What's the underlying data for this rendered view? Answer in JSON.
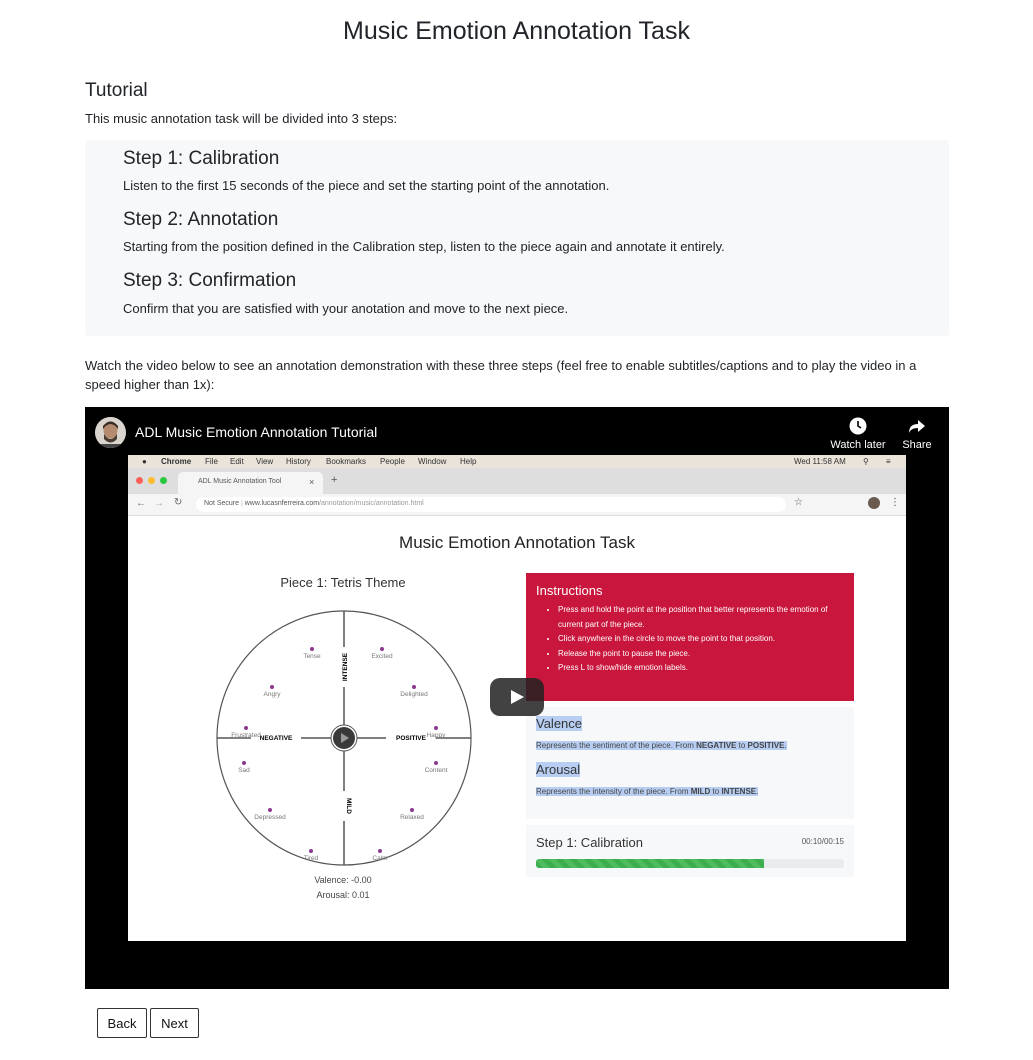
{
  "page": {
    "title": "Music Emotion Annotation Task",
    "section_title": "Tutorial",
    "intro": "This music annotation task will be divided into 3 steps:",
    "steps": [
      {
        "title": "Step 1: Calibration",
        "text": "Listen to the first 15 seconds of the piece and set the starting point of the annotation."
      },
      {
        "title": "Step 2: Annotation",
        "text": "Starting from the position defined in the Calibration step, listen to the piece again and annotate it entirely."
      },
      {
        "title": "Step 3: Confirmation",
        "text": "Confirm that you are satisfied with your anotation and move to the next piece."
      }
    ],
    "video_text": "Watch the video below to see an annotation demonstration with these three steps (feel free to enable subtitles/captions and to play the video in a speed higher than 1x):"
  },
  "video": {
    "title": "ADL Music Emotion Annotation Tutorial",
    "watch_later": "Watch later",
    "share": "Share",
    "screen": {
      "menubar": [
        "Chrome",
        "File",
        "Edit",
        "View",
        "History",
        "Bookmarks",
        "People",
        "Window",
        "Help"
      ],
      "clock": "Wed 11:58 AM",
      "tab_title": "ADL Music Annotation Tool",
      "tab_close": "×",
      "new_tab": "+",
      "url_secure": "Not Secure",
      "url_host": "www.lucasnferreira.com",
      "url_path": "/annotation/music/annotation.html",
      "page_title": "Music Emotion Annotation Task",
      "piece_title": "Piece 1: Tetris Theme",
      "axis_labels": {
        "negative": "NEGATIVE",
        "positive": "POSITIVE",
        "intense": "INTENSE",
        "mild": "MILD"
      },
      "emotions": [
        "Tense",
        "Excited",
        "Angry",
        "Delighted",
        "Frustrated",
        "Happy",
        "Sad",
        "Content",
        "Depressed",
        "Relaxed",
        "Tired",
        "Calm"
      ],
      "valence_readout": "Valence: -0.00",
      "arousal_readout": "Arousal: 0.01",
      "instructions_title": "Instructions",
      "instructions": [
        "Press and hold the point at the position that better represents the emotion of current part of the piece.",
        "Click anywhere in the circle to move the point to that position.",
        "Release the point to pause the piece.",
        "Press L to show/hide emotion labels."
      ],
      "valence_title": "Valence",
      "valence_desc_1": "Represents the sentiment of the piece. From ",
      "valence_neg": "NEGATIVE",
      "valence_to": " to ",
      "valence_pos": "POSITIVE",
      "valence_end": ".",
      "arousal_title": "Arousal",
      "arousal_desc_1": "Represents the intensity of the piece. From ",
      "arousal_mild": "MILD",
      "arousal_to": " to ",
      "arousal_intense": "INTENSE",
      "arousal_end": ".",
      "progress_title": "Step 1: Calibration",
      "progress_time": "00:10/00:15",
      "progress_fraction": 0.74
    }
  },
  "buttons": {
    "back": "Back",
    "next": "Next"
  },
  "colors": {
    "instructions_bg": "#c8163c",
    "progress": "#3cae4f",
    "highlight": "#b7cef2"
  }
}
